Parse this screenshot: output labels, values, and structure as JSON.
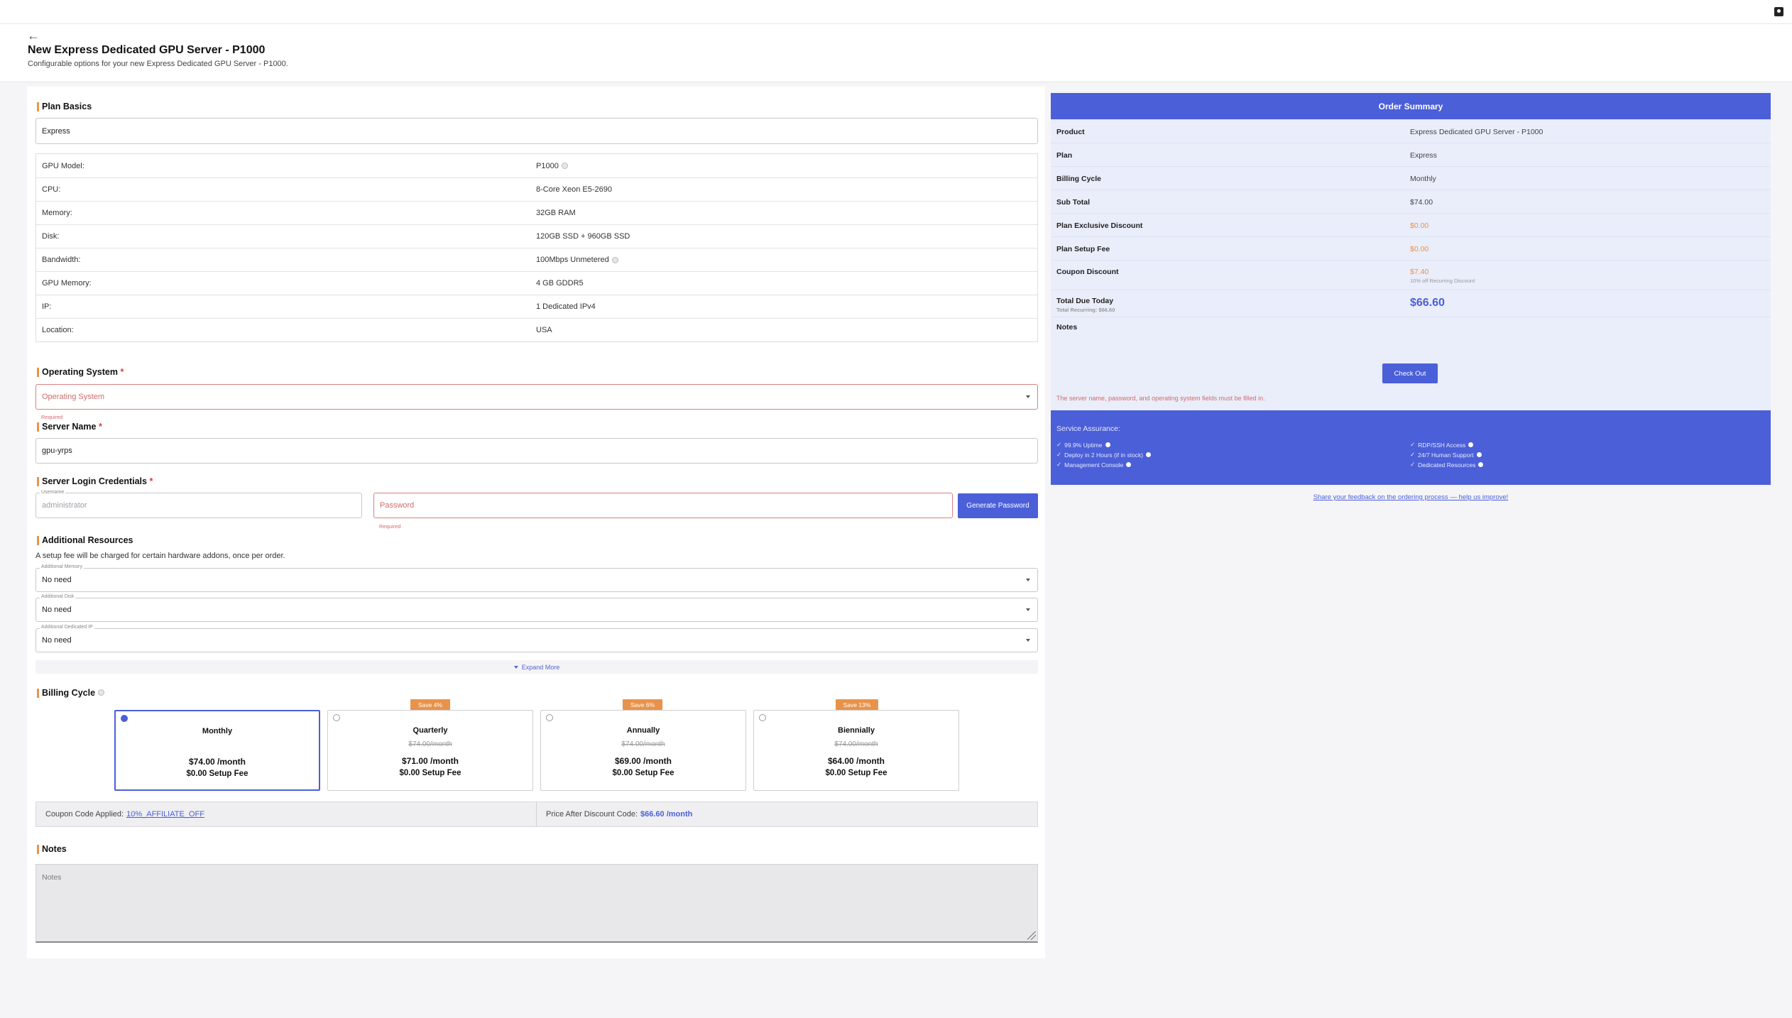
{
  "header": {
    "back_icon": "arrow-left-icon",
    "title": "New Express Dedicated GPU Server - P1000",
    "subtitle": "Configurable options for your new Express Dedicated GPU Server - P1000."
  },
  "plan_basics": {
    "title": "Plan Basics",
    "plan_value": "Express",
    "specs": [
      {
        "label": "GPU Model:",
        "value": "P1000",
        "info": true
      },
      {
        "label": "CPU:",
        "value": "8-Core Xeon E5-2690",
        "info": false
      },
      {
        "label": "Memory:",
        "value": "32GB RAM",
        "info": false
      },
      {
        "label": "Disk:",
        "value": "120GB SSD + 960GB SSD",
        "info": false
      },
      {
        "label": "Bandwidth:",
        "value": "100Mbps Unmetered",
        "info": true
      },
      {
        "label": "GPU Memory:",
        "value": "4 GB GDDR5",
        "info": false
      },
      {
        "label": "IP:",
        "value": "1 Dedicated IPv4",
        "info": false
      },
      {
        "label": "Location:",
        "value": "USA",
        "info": false
      }
    ]
  },
  "os": {
    "title": "Operating System",
    "required_mark": "*",
    "placeholder": "Operating System",
    "error": "Required"
  },
  "server_name": {
    "title": "Server Name",
    "required_mark": "*",
    "value": "gpu-yrps"
  },
  "credentials": {
    "title": "Server Login Credentials",
    "required_mark": "*",
    "username_label": "Username",
    "username_value": "administrator",
    "password_placeholder": "Password",
    "password_error": "Required",
    "generate_label": "Generate Password"
  },
  "resources": {
    "title": "Additional Resources",
    "note": "A setup fee will be charged for certain hardware addons, once per order.",
    "items": [
      {
        "label": "Additional Memory",
        "value": "No need"
      },
      {
        "label": "Additional Disk",
        "value": "No need"
      },
      {
        "label": "Additional Dedicated IP",
        "value": "No need"
      }
    ],
    "expand_label": "Expand More"
  },
  "billing": {
    "title": "Billing Cycle",
    "cycles": [
      {
        "name": "Monthly",
        "strike": "",
        "price": "$74.00 /month",
        "setup": "$0.00 Setup Fee",
        "badge": "",
        "selected": true
      },
      {
        "name": "Quarterly",
        "strike": "$74.00/month",
        "price": "$71.00 /month",
        "setup": "$0.00 Setup Fee",
        "badge": "Save 4%",
        "selected": false
      },
      {
        "name": "Annually",
        "strike": "$74.00/month",
        "price": "$69.00 /month",
        "setup": "$0.00 Setup Fee",
        "badge": "Save 6%",
        "selected": false
      },
      {
        "name": "Biennially",
        "strike": "$74.00/month",
        "price": "$64.00 /month",
        "setup": "$0.00 Setup Fee",
        "badge": "Save 13%",
        "selected": false
      }
    ]
  },
  "coupon": {
    "applied_label": "Coupon Code Applied:",
    "code": "10%_AFFILIATE_OFF",
    "after_label": "Price After Discount Code:",
    "after_value": "$66.60 /month"
  },
  "notes": {
    "title": "Notes",
    "placeholder": "Notes"
  },
  "summary": {
    "title": "Order Summary",
    "rows": [
      {
        "label": "Product",
        "value": "Express Dedicated GPU Server - P1000"
      },
      {
        "label": "Plan",
        "value": "Express"
      },
      {
        "label": "Billing Cycle",
        "value": "Monthly"
      },
      {
        "label": "Sub Total",
        "value": "$74.00"
      },
      {
        "label": "Plan Exclusive Discount",
        "value": "$0.00"
      },
      {
        "label": "Plan Setup Fee",
        "value": "$0.00"
      }
    ],
    "coupon_label": "Coupon Discount",
    "coupon_value": "$7.40",
    "coupon_note": "10% off Recurring Discount",
    "total_label": "Total Due Today",
    "total_recurring": "Total Recurring: $66.60",
    "total_value": "$66.60",
    "notes_label": "Notes",
    "checkout_label": "Check Out",
    "warning": "The server name, password, and operating system fields must be filled in.",
    "assurance_title": "Service Assurance:",
    "assurance_left": [
      "99.9% Uptime",
      "Deploy in 2 Hours (if in stock)",
      "Management Console"
    ],
    "assurance_right": [
      "RDP/SSH Access",
      "24/7 Human Support",
      "Dedicated Resources"
    ],
    "feedback": "Share your feedback on the ordering process — help us improve!"
  },
  "colors": {
    "accent": "#4a5fd8",
    "orange": "#e8934a",
    "error": "#d16c6c"
  }
}
